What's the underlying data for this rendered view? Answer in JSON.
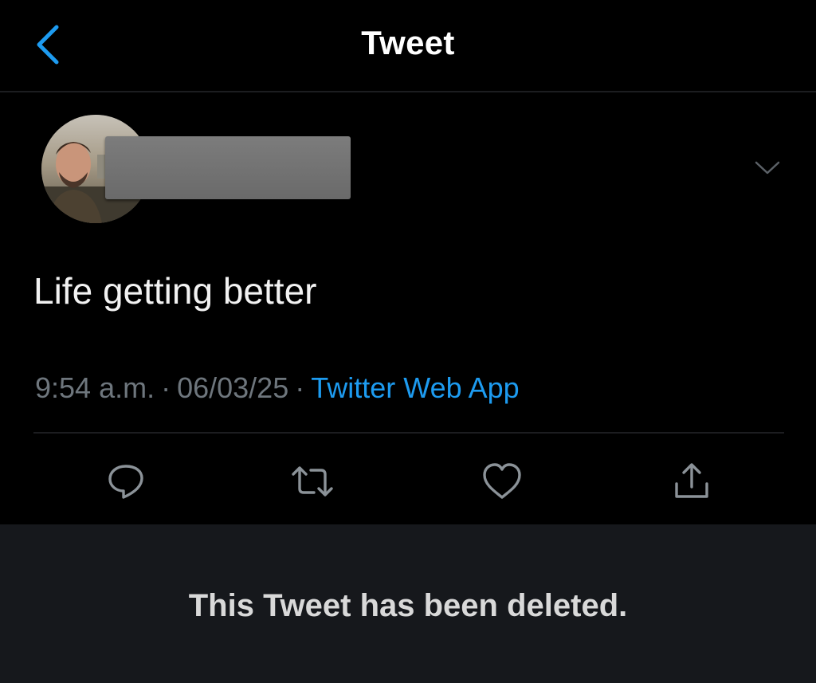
{
  "header": {
    "title": "Tweet",
    "back_icon": "chevron-left-icon"
  },
  "author": {
    "avatar": "avatar-photo",
    "name_redacted": true
  },
  "tweet": {
    "text": "Life getting better",
    "time": "9:54 a.m.",
    "separator": "·",
    "date": "06/03/25",
    "source": "Twitter Web App"
  },
  "actions": [
    {
      "name": "reply",
      "icon": "reply-icon"
    },
    {
      "name": "retweet",
      "icon": "retweet-icon"
    },
    {
      "name": "like",
      "icon": "heart-icon"
    },
    {
      "name": "share",
      "icon": "share-icon"
    }
  ],
  "notice": {
    "text": "This Tweet has been deleted."
  },
  "colors": {
    "background": "#000000",
    "accent": "#1d9bf0",
    "muted_text": "#6e767d",
    "panel": "#16181c"
  }
}
